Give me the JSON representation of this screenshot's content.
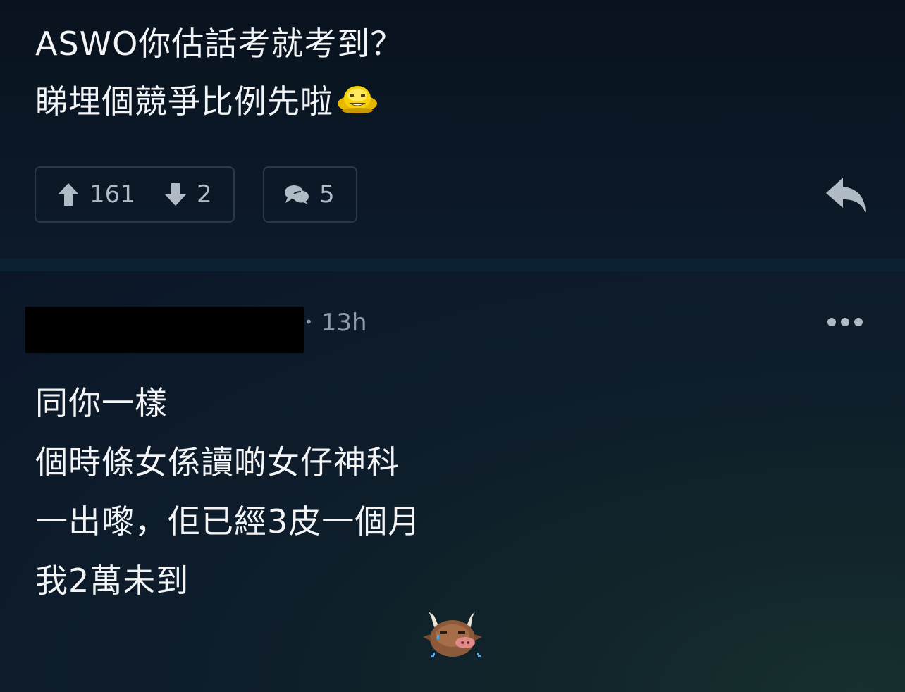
{
  "post": {
    "lines": [
      "ASWO你估話考就考到？",
      "睇埋個競爭比例先啦"
    ],
    "emoji_icon": "grinning-face-emoji-icon",
    "upvotes": "161",
    "downvotes": "2",
    "comment_count": "5"
  },
  "reply": {
    "time": "13h",
    "lines": [
      "同你一樣",
      "個時條女係讀啲女仔神科",
      "一出嚟，佢已經3皮一個月",
      "我2萬未到"
    ],
    "sticker_icon": "crying-bull-emoji-icon"
  },
  "colors": {
    "text": "#f2f4f6",
    "muted": "#b0bac5",
    "border": "#28394b",
    "divider": "#0a2233",
    "background": "#0a1626"
  },
  "icons": {
    "upvote": "arrow-up-icon",
    "downvote": "arrow-down-icon",
    "comments": "chat-bubbles-icon",
    "reply": "reply-arrow-icon",
    "more": "more-dots-icon"
  }
}
